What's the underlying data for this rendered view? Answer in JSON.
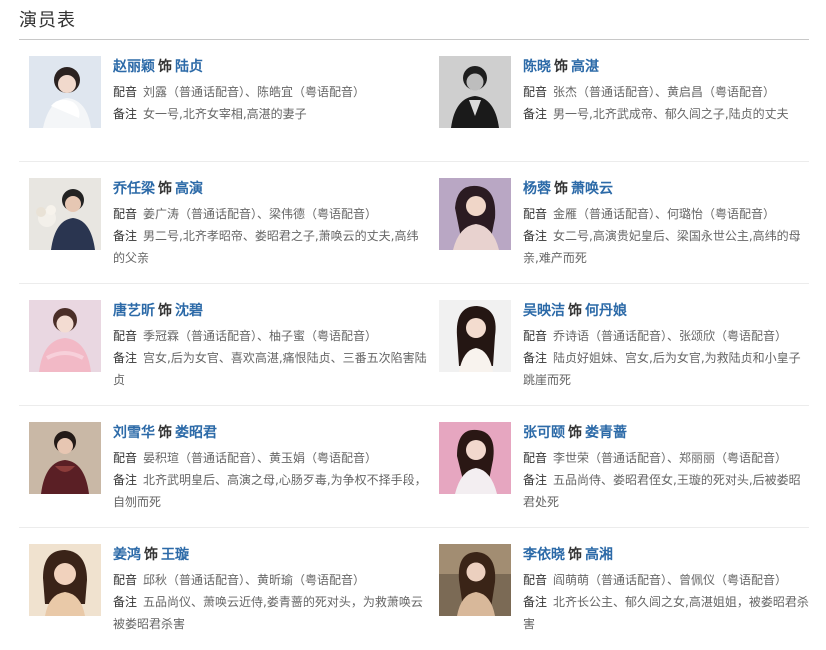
{
  "section_title": "演员表",
  "labels": {
    "dub": "配音",
    "note": "备注",
    "as": "饰"
  },
  "cast": [
    {
      "actor": "赵丽颖",
      "role": "陆贞",
      "dub": "刘露（普通话配音）、陈皓宜（粤语配音）",
      "note": "女一号,北齐女宰相,高湛的妻子",
      "photo": "photo-zhaoliying"
    },
    {
      "actor": "陈晓",
      "role": "高湛",
      "dub": "张杰（普通话配音）、黄启昌（粤语配音）",
      "note": "男一号,北齐武成帝、郁久闾之子,陆贞的丈夫",
      "photo": "photo-chenxiao"
    },
    {
      "actor": "乔任梁",
      "role": "高演",
      "dub": "姜广涛（普通话配音）、梁伟德（粤语配音）",
      "note": "男二号,北齐孝昭帝、娄昭君之子,萧唤云的丈夫,高纬的父亲",
      "photo": "photo-qiaorenliang"
    },
    {
      "actor": "杨蓉",
      "role": "萧唤云",
      "dub": "金雁（普通话配音）、何璐怡（粤语配音）",
      "note": "女二号,高演贵妃皇后、梁国永世公主,高纬的母亲,难产而死",
      "photo": "photo-yangrong"
    },
    {
      "actor": "唐艺昕",
      "role": "沈碧",
      "dub": "季冠霖（普通话配音）、柚子蜜（粤语配音）",
      "note": "宫女,后为女官、喜欢高湛,痛恨陆贞、三番五次陷害陆贞",
      "photo": "photo-tangyixin"
    },
    {
      "actor": "吴映洁",
      "role": "何丹娘",
      "dub": "乔诗语（普通话配音）、张颂欣（粤语配音）",
      "note": "陆贞好姐妹、宫女,后为女官,为救陆贞和小皇子跳崖而死",
      "photo": "photo-wuyingjie"
    },
    {
      "actor": "刘雪华",
      "role": "娄昭君",
      "dub": "晏积瑄（普通话配音）、黄玉娟（粤语配音）",
      "note": "北齐武明皇后、高演之母,心肠歹毒,为争权不择手段，自刎而死",
      "photo": "photo-liuxuehua"
    },
    {
      "actor": "张可颐",
      "role": "娄青蔷",
      "dub": "李世荣（普通话配音）、郑丽丽（粤语配音）",
      "note": "五品尚侍、娄昭君侄女,王璇的死对头,后被娄昭君处死",
      "photo": "photo-zhangkeyi"
    },
    {
      "actor": "姜鸿",
      "role": "王璇",
      "dub": "邱秋（普通话配音）、黄昕瑜（粤语配音）",
      "note": "五品尚仪、萧唤云近侍,娄青蔷的死对头，为救萧唤云被娄昭君杀害",
      "photo": "photo-jianghong"
    },
    {
      "actor": "李依晓",
      "role": "高湘",
      "dub": "阎萌萌（普通话配音）、曾佩仪（粤语配音）",
      "note": "北齐长公主、郁久闾之女,高湛姐姐，被娄昭君杀害",
      "photo": "photo-liyixiao"
    }
  ],
  "colors": {
    "link": "#2c6aa8",
    "text": "#666666",
    "label": "#333333",
    "divider": "#ececec"
  }
}
